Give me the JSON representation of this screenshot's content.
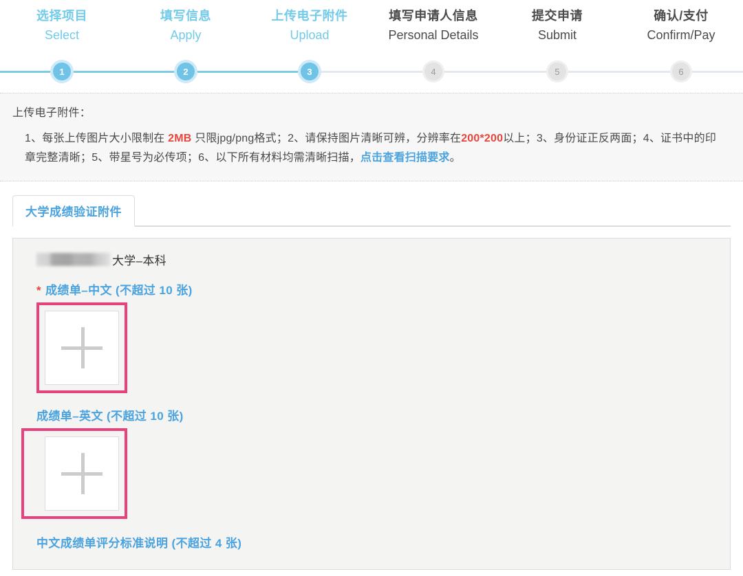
{
  "stepper": {
    "steps": [
      {
        "cn": "选择项目",
        "en": "Select",
        "number": "1",
        "state": "done"
      },
      {
        "cn": "填写信息",
        "en": "Apply",
        "number": "2",
        "state": "done"
      },
      {
        "cn": "上传电子附件",
        "en": "Upload",
        "number": "3",
        "state": "done"
      },
      {
        "cn": "填写申请人信息",
        "en": "Personal Details",
        "number": "4",
        "state": "todo"
      },
      {
        "cn": "提交申请",
        "en": "Submit",
        "number": "5",
        "state": "todo"
      },
      {
        "cn": "确认/支付",
        "en": "Confirm/Pay",
        "number": "6",
        "state": "todo"
      }
    ]
  },
  "notice": {
    "title": "上传电子附件：",
    "part1": "1、每张上传图片大小限制在 ",
    "size_limit": "2MB",
    "part2": " 只限jpg/png格式；2、请保持图片清晰可辨，分辨率在",
    "resolution": "200*200",
    "part3": "以上；3、身份证正反两面；4、证书中的印章完整清晰；5、带星号为必传项；6、以下所有材料均需清晰扫描，",
    "link_text": "点击查看扫描要求",
    "part4": "。"
  },
  "tabs": [
    {
      "label": "大学成绩验证附件",
      "active": true
    }
  ],
  "panel": {
    "school_suffix": "大学–本科",
    "fields": [
      {
        "required": true,
        "star": "*",
        "label": "成绩单–中文 (不超过 10 张)",
        "highlighted": true,
        "upload_icon": "plus-icon"
      },
      {
        "required": false,
        "label": "成绩单–英文 (不超过 10 张)",
        "highlighted": true,
        "upload_icon": "plus-icon"
      },
      {
        "required": false,
        "label": "中文成绩单评分标准说明 (不超过 4 张)",
        "highlighted": false
      }
    ]
  },
  "colors": {
    "accent_blue": "#4aa3df",
    "step_blue": "#72cbe9",
    "alert_red": "#e8453c",
    "highlight_pink": "#e8417d",
    "panel_bg": "#f4f4f2",
    "notice_bg": "#f7f7f7"
  }
}
